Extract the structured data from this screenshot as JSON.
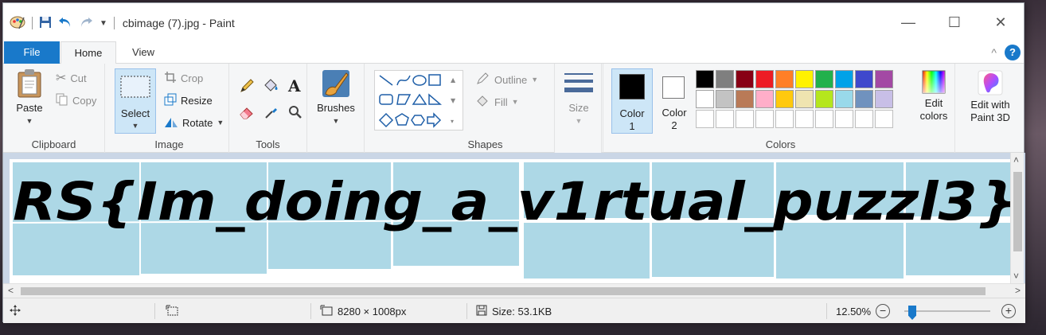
{
  "titlebar": {
    "title": "cbimage (7).jpg - Paint",
    "minimize": "—",
    "maximize": "☐",
    "close": "✕"
  },
  "tabs": {
    "file": "File",
    "home": "Home",
    "view": "View",
    "collapse": "^",
    "help": "?"
  },
  "clipboard": {
    "paste": "Paste",
    "cut": "Cut",
    "copy": "Copy",
    "label": "Clipboard"
  },
  "image": {
    "select": "Select",
    "crop": "Crop",
    "resize": "Resize",
    "rotate": "Rotate",
    "label": "Image"
  },
  "tools": {
    "label": "Tools",
    "text_glyph": "A"
  },
  "brushes": {
    "label": "Brushes"
  },
  "shapes": {
    "outline": "Outline",
    "fill": "Fill",
    "label": "Shapes"
  },
  "size": {
    "label": "Size"
  },
  "colors": {
    "color1_line1": "Color",
    "color1_line2": "1",
    "color2_line1": "Color",
    "color2_line2": "2",
    "edit_line1": "Edit",
    "edit_line2": "colors",
    "label": "Colors",
    "color1_value": "#000000",
    "color2_value": "#ffffff",
    "palette": [
      "#000000",
      "#7f7f7f",
      "#880015",
      "#ed1c24",
      "#ff7f27",
      "#fff200",
      "#22b14c",
      "#00a2e8",
      "#3f48cc",
      "#a349a4",
      "#ffffff",
      "#c3c3c3",
      "#b97a57",
      "#ffaec9",
      "#ffc90e",
      "#efe4b0",
      "#b5e61d",
      "#99d9ea",
      "#7092be",
      "#c8bfe7"
    ]
  },
  "paint3d": {
    "line1": "Edit with",
    "line2": "Paint 3D"
  },
  "canvas": {
    "flag_text": "RS{Im_doing_a_v1rtual_puzzl3}",
    "tile_color": "#add8e6"
  },
  "statusbar": {
    "dimensions": "8280 × 1008px",
    "size": "Size: 53.1KB",
    "zoom": "12.50%",
    "zoom_out": "−",
    "zoom_in": "+",
    "zoom_level_fraction": 0.05
  }
}
